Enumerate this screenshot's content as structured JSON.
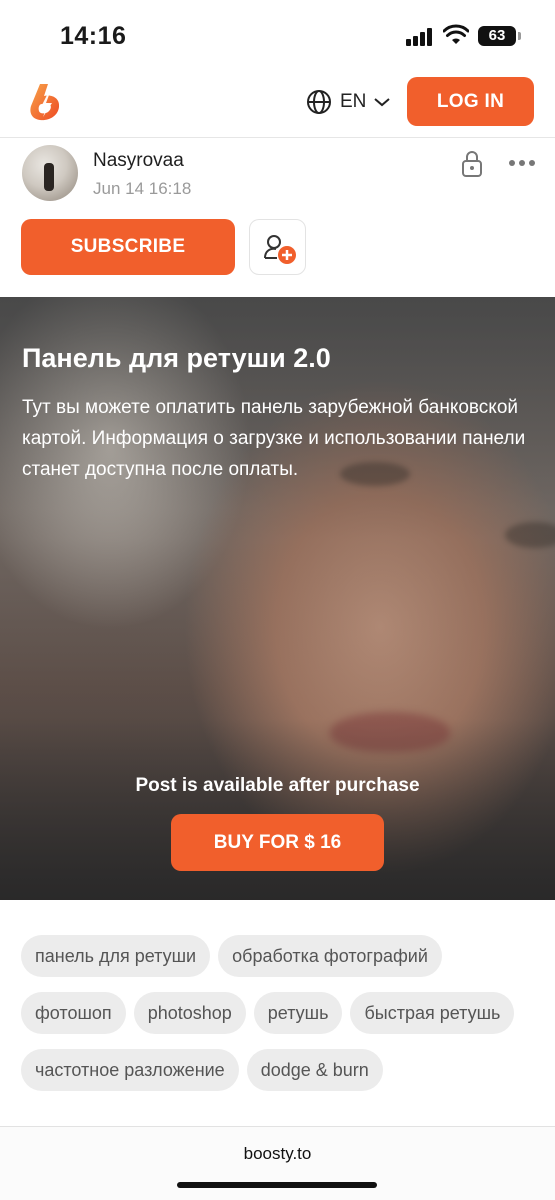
{
  "status_bar": {
    "time": "14:16",
    "battery": "63"
  },
  "header": {
    "language": "EN",
    "login_label": "LOG IN"
  },
  "author": {
    "name": "Nasyrovaa",
    "date": "Jun 14 16:18"
  },
  "actions": {
    "subscribe_label": "SUBSCRIBE"
  },
  "post": {
    "title": "Панель для ретуши 2.0",
    "description": "Тут вы можете оплатить панель зарубежной банковской картой. Информация о загрузке и использовании панели станет доступна после оплаты.",
    "locked_message": "Post is available after purchase",
    "buy_label": "BUY FOR $ 16"
  },
  "tags": [
    "панель для ретуши",
    "обработка фотографий",
    "фотошоп",
    "photoshop",
    "ретушь",
    "быстрая ретушь",
    "частотное разложение",
    "dodge & burn"
  ],
  "browser": {
    "url": "boosty.to"
  },
  "colors": {
    "accent": "#f15f2c",
    "tag_bg": "#ececec"
  }
}
